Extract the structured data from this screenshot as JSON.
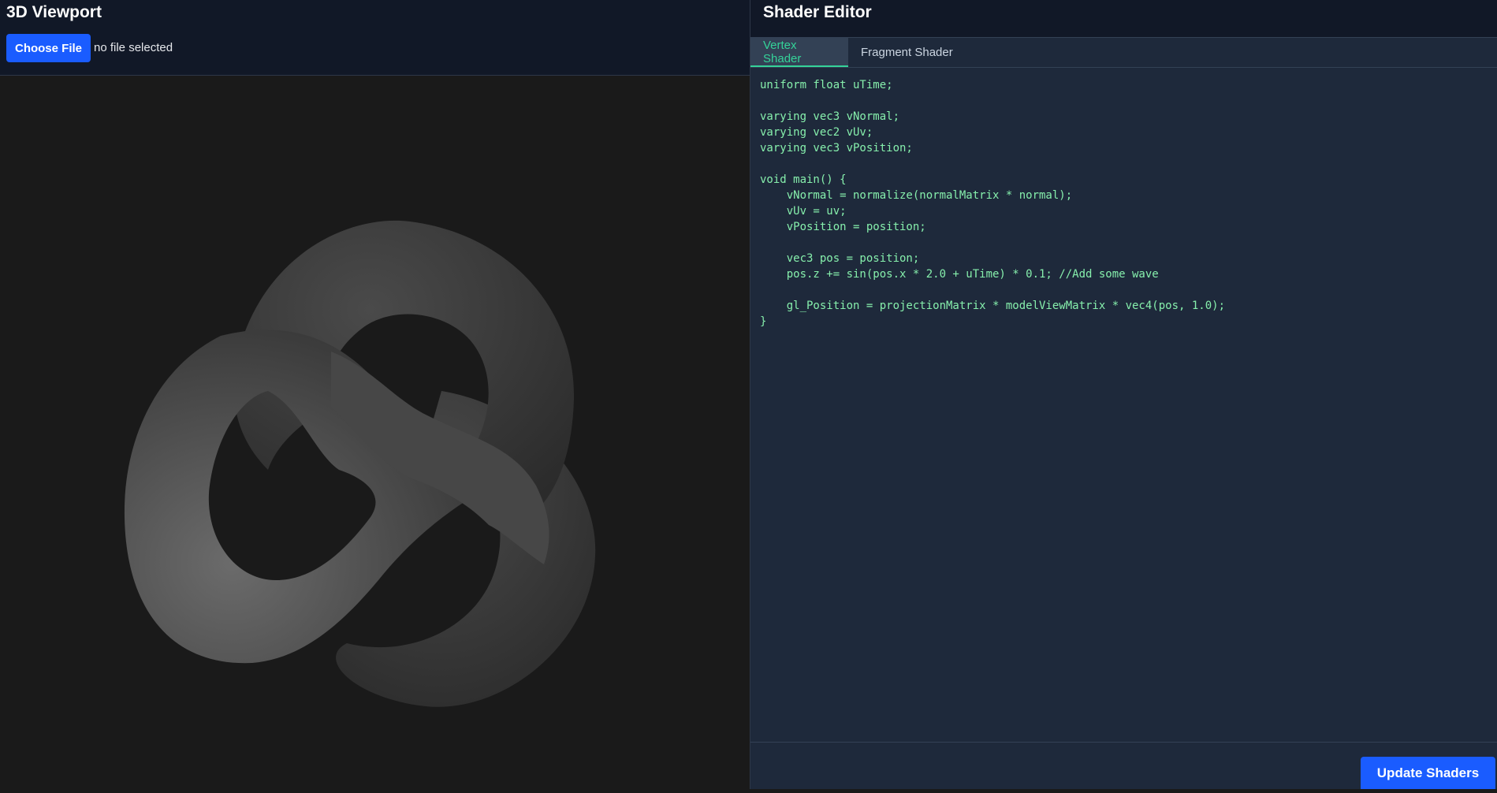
{
  "viewport": {
    "title": "3D Viewport",
    "choose_file_label": "Choose File",
    "file_status": "no file selected",
    "background_color": "#1a1a1a"
  },
  "editor": {
    "title": "Shader Editor",
    "tabs": [
      {
        "label": "Vertex Shader",
        "active": true
      },
      {
        "label": "Fragment Shader",
        "active": false
      }
    ],
    "code": "uniform float uTime;\n\nvarying vec3 vNormal;\nvarying vec2 vUv;\nvarying vec3 vPosition;\n\nvoid main() {\n    vNormal = normalize(normalMatrix * normal);\n    vUv = uv;\n    vPosition = position;\n\n    vec3 pos = position;\n    pos.z += sin(pos.x * 2.0 + uTime) * 0.1; //Add some wave\n\n    gl_Position = projectionMatrix * modelViewMatrix * vec4(pos, 1.0);\n}",
    "update_label": "Update Shaders",
    "accent_color": "#34d399",
    "button_color": "#1a5cff"
  }
}
